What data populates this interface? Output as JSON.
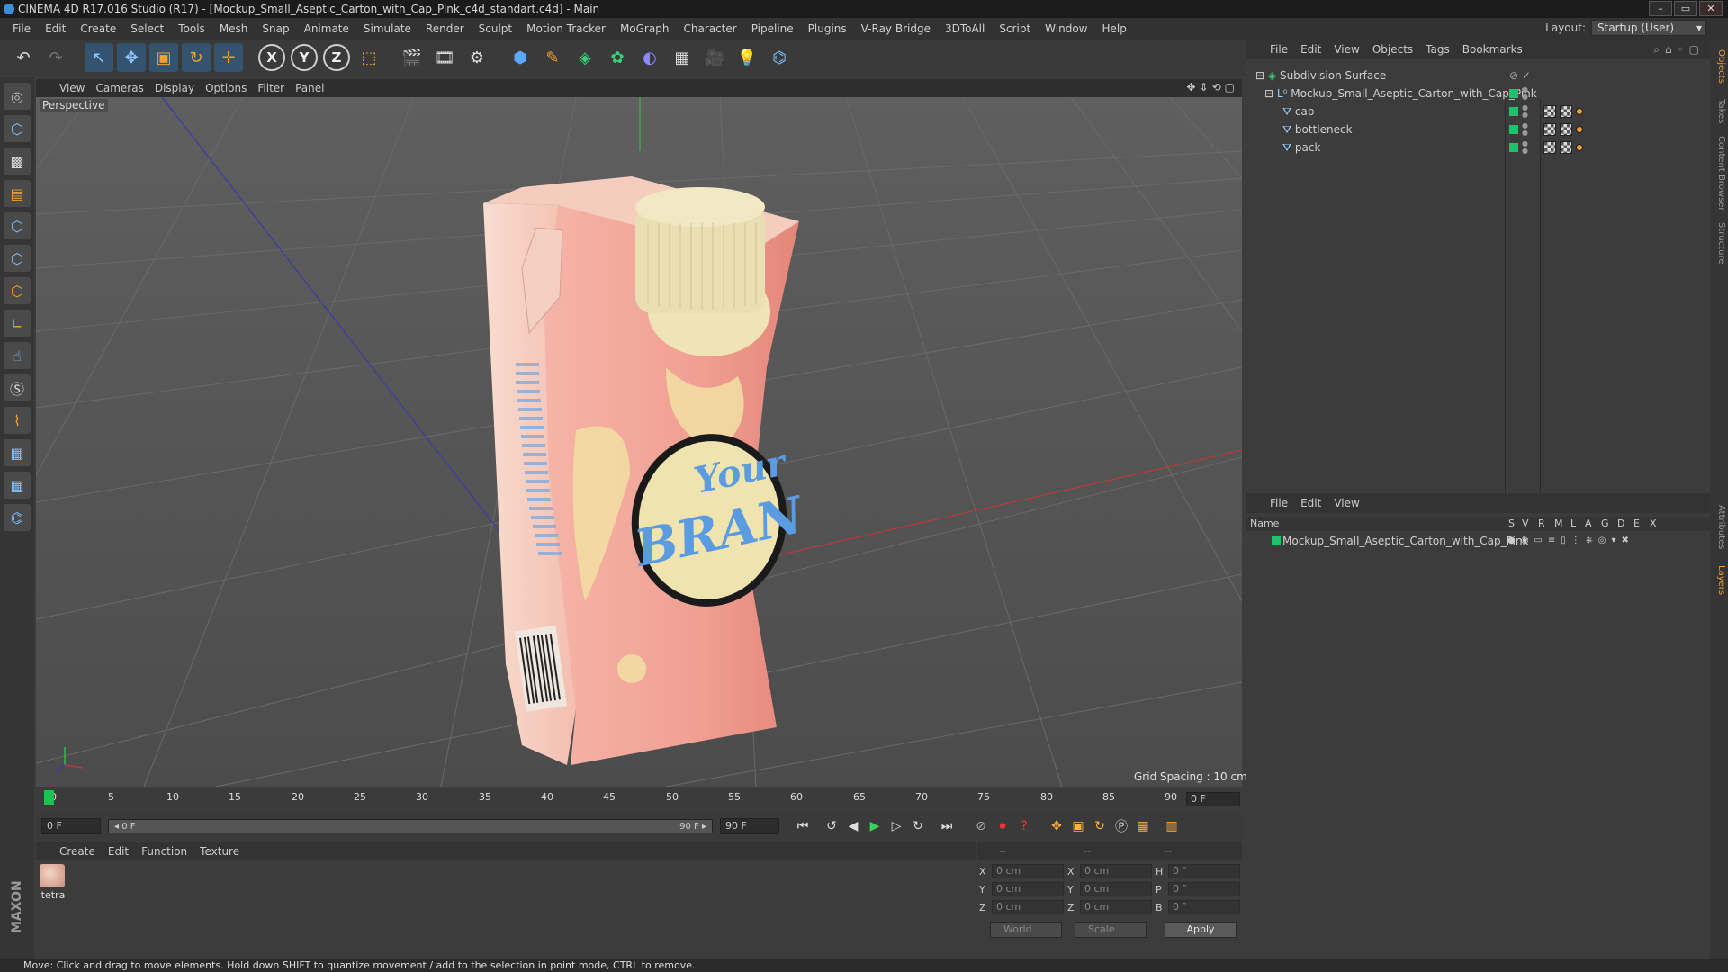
{
  "window": {
    "title": "CINEMA 4D R17.016 Studio (R17) - [Mockup_Small_Aseptic_Carton_with_Cap_Pink_c4d_standart.c4d] - Main",
    "buttons": [
      "–",
      "▭",
      "✕"
    ]
  },
  "menubar": {
    "items": [
      "File",
      "Edit",
      "Create",
      "Select",
      "Tools",
      "Mesh",
      "Snap",
      "Animate",
      "Simulate",
      "Render",
      "Sculpt",
      "Motion Tracker",
      "MoGraph",
      "Character",
      "Pipeline",
      "Plugins",
      "V-Ray Bridge",
      "3DToAll",
      "Script",
      "Window",
      "Help"
    ],
    "layout_label": "Layout:",
    "layout_value": "Startup (User)"
  },
  "toolbar": {
    "axis_x": "X",
    "axis_y": "Y",
    "axis_z": "Z"
  },
  "viewport": {
    "menu": [
      "View",
      "Cameras",
      "Display",
      "Options",
      "Filter",
      "Panel"
    ],
    "camera_label": "Perspective",
    "grid_spacing": "Grid Spacing : 10 cm",
    "label_text_1": "Your",
    "label_text_2": "BRAN"
  },
  "timeline": {
    "ticks": [
      "0",
      "5",
      "10",
      "15",
      "20",
      "25",
      "30",
      "35",
      "40",
      "45",
      "50",
      "55",
      "60",
      "65",
      "70",
      "75",
      "80",
      "85",
      "90"
    ],
    "current_frame": "0 F",
    "start_field": "0 F",
    "range_start": "◂ 0 F",
    "range_end": "90 F ▸",
    "end_field": "90 F"
  },
  "material_panel": {
    "menu": [
      "Create",
      "Edit",
      "Function",
      "Texture"
    ],
    "material_name": "tetra"
  },
  "coord_panel": {
    "headers": [
      "--",
      "--",
      "--"
    ],
    "rows": [
      {
        "a": "X",
        "av": "0 cm",
        "b": "X",
        "bv": "0 cm",
        "c": "H",
        "cv": "0 °"
      },
      {
        "a": "Y",
        "av": "0 cm",
        "b": "Y",
        "bv": "0 cm",
        "c": "P",
        "cv": "0 °"
      },
      {
        "a": "Z",
        "av": "0 cm",
        "b": "Z",
        "bv": "0 cm",
        "c": "B",
        "cv": "0 °"
      }
    ],
    "mode_world": "World",
    "mode_scale": "Scale",
    "apply": "Apply"
  },
  "object_manager": {
    "menu": [
      "File",
      "Edit",
      "View",
      "Objects",
      "Tags",
      "Bookmarks"
    ],
    "objects": [
      {
        "name": "Subdivision Surface"
      },
      {
        "name": "Mockup_Small_Aseptic_Carton_with_Cap_Pink"
      },
      {
        "name": "cap"
      },
      {
        "name": "bottleneck"
      },
      {
        "name": "pack"
      }
    ]
  },
  "layer_manager": {
    "menu": [
      "File",
      "Edit",
      "View"
    ],
    "columns": [
      "Name",
      "S",
      "V",
      "R",
      "M",
      "L",
      "A",
      "G",
      "D",
      "E",
      "X"
    ],
    "layer_name": "Mockup_Small_Aseptic_Carton_with_Cap_Pink"
  },
  "right_tabs": [
    "Objects",
    "Takes",
    "Content Browser",
    "Structure",
    "Attributes",
    "Layers"
  ],
  "branding": "MAXON CINEMA 4D",
  "status": "Move: Click and drag to move elements. Hold down SHIFT to quantize movement / add to the selection in point mode, CTRL to remove.",
  "colors": {
    "layer_green": "#1fc26a",
    "playhead_green": "#1ec050",
    "carton_pink": "#f1a59a",
    "cap_cream": "#efe3b8",
    "label_blue": "#5b9be0"
  }
}
